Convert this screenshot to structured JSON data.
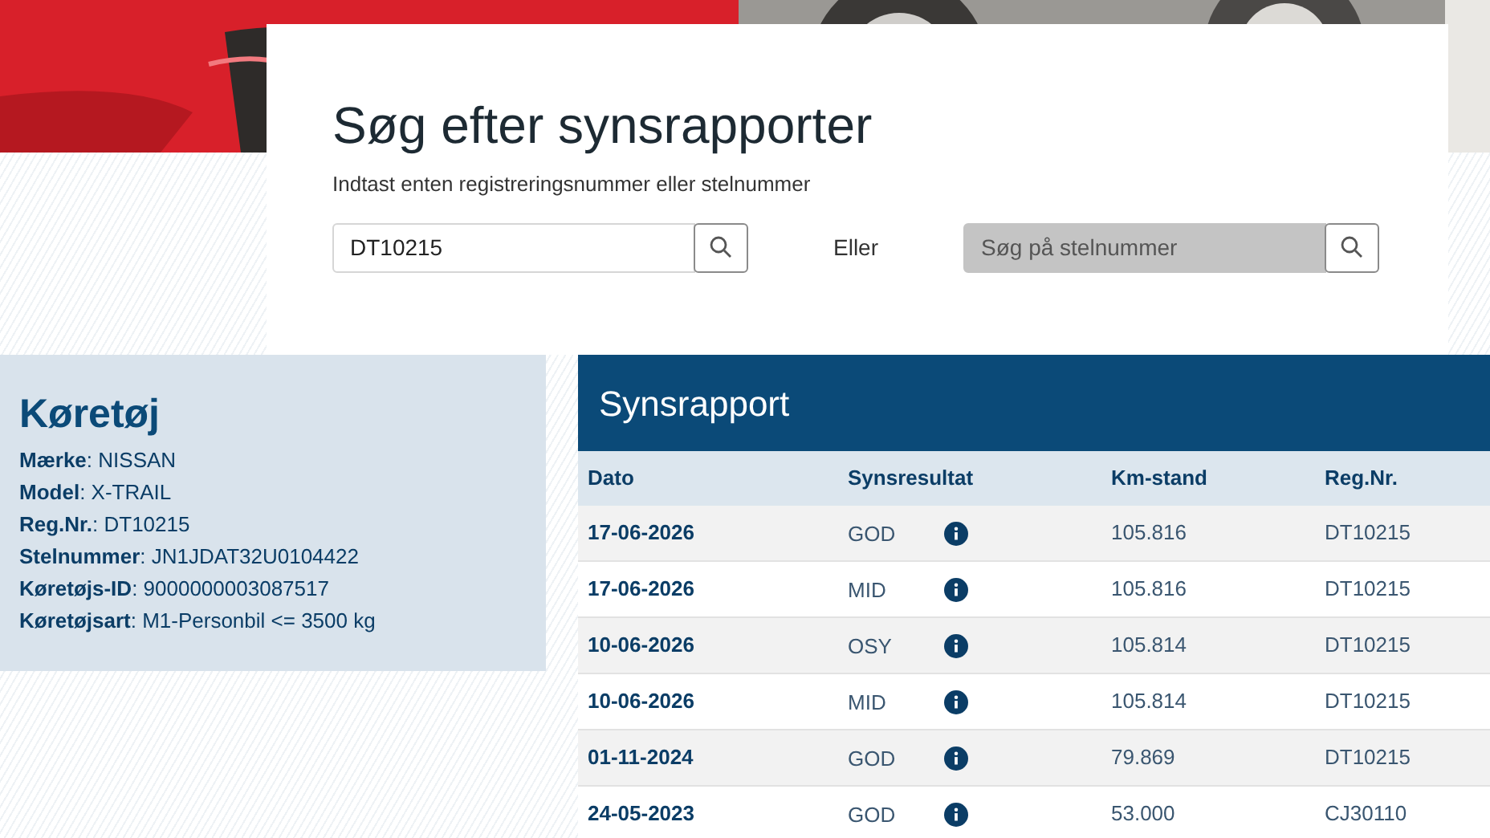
{
  "search": {
    "title": "Søg efter synsrapporter",
    "subtitle": "Indtast enten registreringsnummer eller stelnummer",
    "reg_field": {
      "value": "DT10215",
      "disabled": false
    },
    "separator": "Eller",
    "vin_field": {
      "placeholder": "Søg på stelnummer",
      "disabled": true
    }
  },
  "vehicle": {
    "title": "Køretøj",
    "fields": [
      "**Mærke**: NISSAN",
      "**Model**: X-TRAIL",
      "**Reg.Nr.**: DT10215",
      "**Stelnummer**: JN1JDAT32U0104422",
      "**Køretøjs-ID**: 9000000003087517",
      "**Køretøjsart**: M1-Personbil <= 3500 kg"
    ]
  },
  "report": {
    "title": "Synsrapport",
    "columns": [
      "Dato",
      "Synsresultat",
      "Km-stand",
      "Reg.Nr."
    ],
    "rows": [
      {
        "date": "17-06-2026",
        "result": "GOD",
        "km": "105.816",
        "reg": "DT10215"
      },
      {
        "date": "17-06-2026",
        "result": "MID",
        "km": "105.816",
        "reg": "DT10215"
      },
      {
        "date": "10-06-2026",
        "result": "OSY",
        "km": "105.814",
        "reg": "DT10215"
      },
      {
        "date": "10-06-2026",
        "result": "MID",
        "km": "105.814",
        "reg": "DT10215"
      },
      {
        "date": "01-11-2024",
        "result": "GOD",
        "km": "79.869",
        "reg": "DT10215"
      },
      {
        "date": "24-05-2023",
        "result": "GOD",
        "km": "53.000",
        "reg": "CJ30110"
      }
    ]
  }
}
